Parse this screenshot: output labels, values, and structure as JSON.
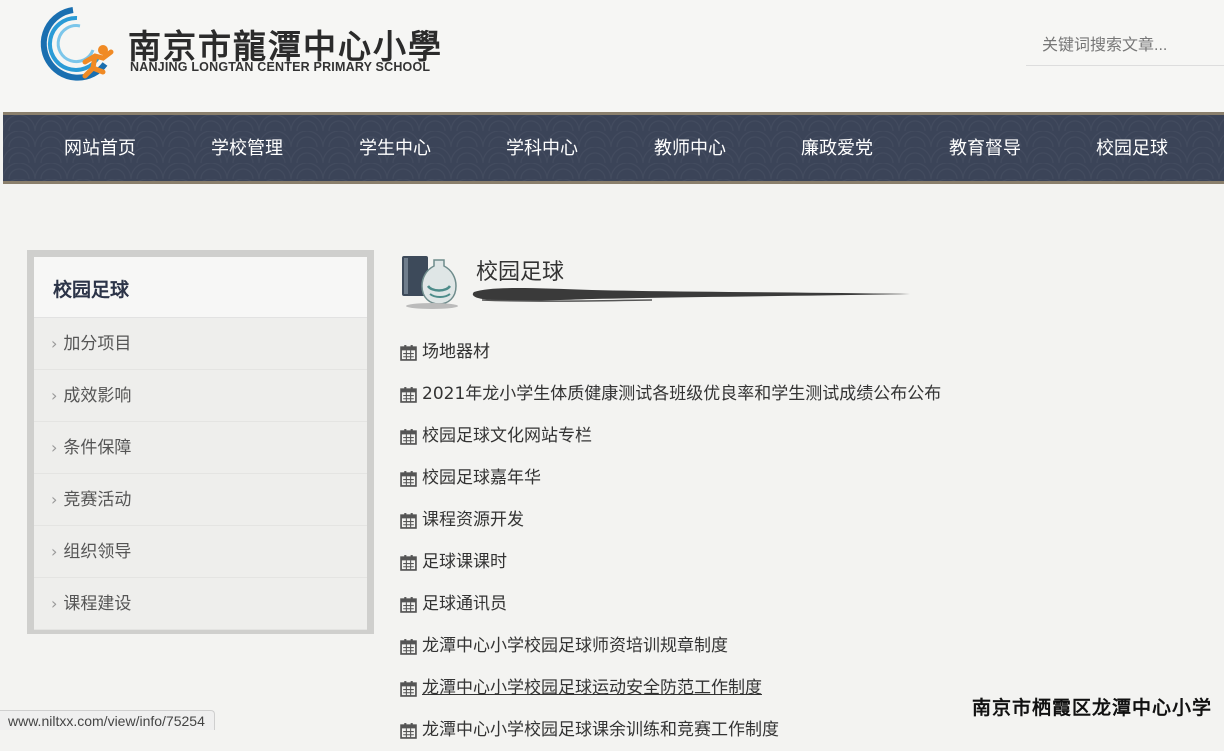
{
  "header": {
    "logo_cn": "南京市龍潭中心小學",
    "logo_en": "NANJING LONGTAN CENTER PRIMARY SCHOOL",
    "search_placeholder": "关键词搜索文章..."
  },
  "nav": {
    "items": [
      "网站首页",
      "学校管理",
      "学生中心",
      "学科中心",
      "教师中心",
      "廉政爱党",
      "教育督导",
      "校园足球"
    ]
  },
  "sidebar": {
    "title": "校园足球",
    "items": [
      "加分项目",
      "成效影响",
      "条件保障",
      "竞赛活动",
      "组织领导",
      "课程建设"
    ]
  },
  "main": {
    "title": "校园足球",
    "articles": [
      "场地器材",
      "2021年龙小学生体质健康测试各班级优良率和学生测试成绩公布公布",
      "校园足球文化网站专栏",
      "校园足球嘉年华",
      "课程资源开发",
      "足球课课时",
      "足球通讯员",
      "龙潭中心小学校园足球师资培训规章制度",
      "龙潭中心小学校园足球运动安全防范工作制度",
      "龙潭中心小学校园足球课余训练和竞赛工作制度"
    ]
  },
  "status_url": "www.niltxx.com/view/info/75254",
  "watermark": "南京市栖霞区龙潭中心小学",
  "colors": {
    "nav_bg": "#3b4458",
    "nav_border": "#8a7f6c",
    "sidebar_title": "#2c3448",
    "logo_blue": "#1a6fb0",
    "logo_orange": "#f08a24"
  }
}
